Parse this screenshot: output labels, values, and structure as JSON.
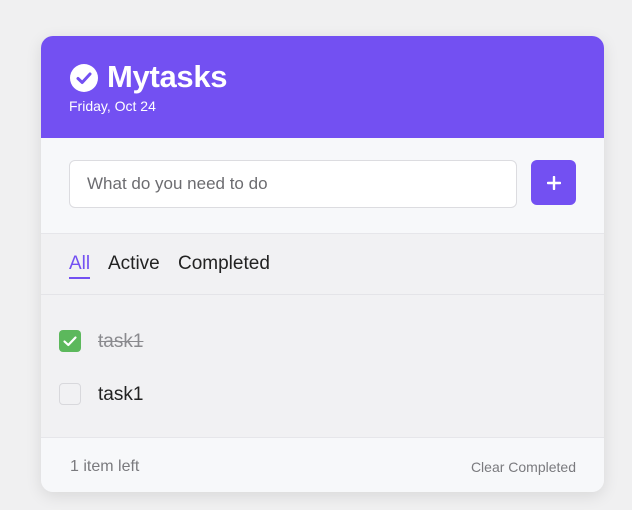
{
  "app": {
    "title": "Mytasks",
    "date": "Friday, Oct 24",
    "brand_icon": "check-circle-icon"
  },
  "add_task": {
    "placeholder": "What do you need to do",
    "value": "",
    "button_icon": "plus-icon"
  },
  "filters": {
    "tabs": [
      {
        "label": "All",
        "active": true
      },
      {
        "label": "Active",
        "active": false
      },
      {
        "label": "Completed",
        "active": false
      }
    ]
  },
  "tasks": [
    {
      "text": "task1",
      "completed": true
    },
    {
      "text": "task1",
      "completed": false
    }
  ],
  "footer": {
    "items_left": "1 item left",
    "clear_label": "Clear Completed"
  },
  "colors": {
    "accent": "#7350f2",
    "checked": "#5cb85c",
    "background": "#f0f0f1"
  }
}
